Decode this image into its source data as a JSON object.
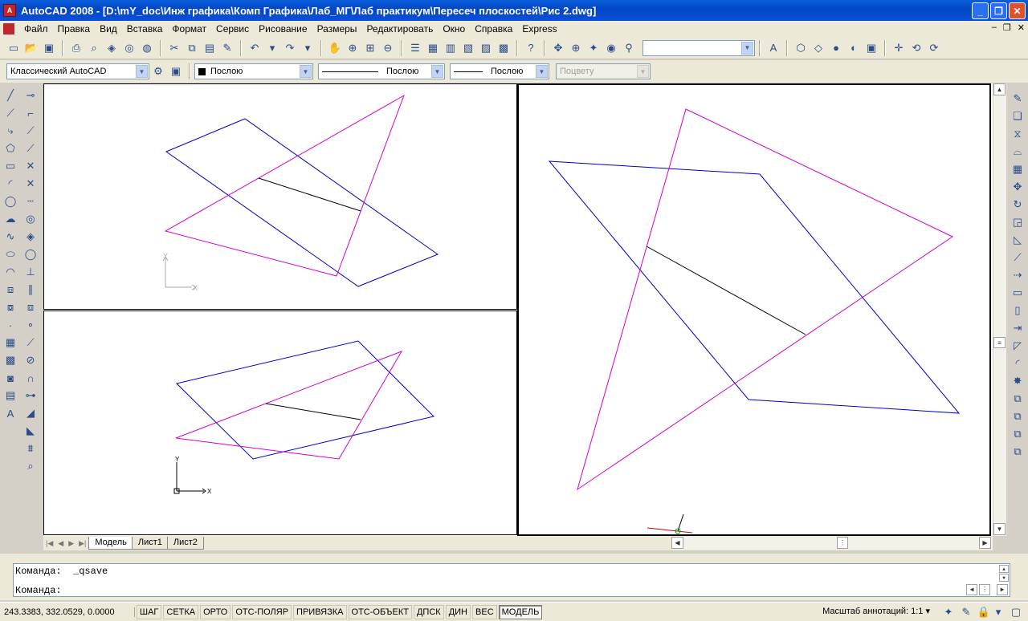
{
  "window": {
    "title": "AutoCAD 2008 - [D:\\mY_doc\\Инж графика\\Комп Графика\\Лаб_МГ\\Лаб практикум\\Пересеч плоскостей\\Рис 2.dwg]",
    "logo_text": "A",
    "minimize": "_",
    "restore": "❐",
    "close": "✕"
  },
  "menu": {
    "items": [
      "Файл",
      "Правка",
      "Вид",
      "Вставка",
      "Формат",
      "Сервис",
      "Рисование",
      "Размеры",
      "Редактировать",
      "Окно",
      "Справка",
      "Express"
    ],
    "doc_minimize": "–",
    "doc_restore": "❐",
    "doc_close": "✕"
  },
  "toolbar": {
    "workspace": "Классический AutoCAD",
    "layer": "Послою",
    "linetype": "Послою",
    "lineweight": "Послою",
    "plotstyle": "Поцвету",
    "top_combo_value": ""
  },
  "tabs": [
    "Модель",
    "Лист1",
    "Лист2"
  ],
  "command": {
    "line1": "Команда:  _qsave",
    "line2": "Команда:"
  },
  "status": {
    "coords": "243.3383, 332.0529, 0.0000",
    "buttons": [
      {
        "label": "ШАГ",
        "active": false
      },
      {
        "label": "СЕТКА",
        "active": false
      },
      {
        "label": "ОРТО",
        "active": false
      },
      {
        "label": "ОТС-ПОЛЯР",
        "active": false
      },
      {
        "label": "ПРИВЯЗКА",
        "active": false
      },
      {
        "label": "ОТС-ОБЪЕКТ",
        "active": false
      },
      {
        "label": "ДПСК",
        "active": false
      },
      {
        "label": "ДИН",
        "active": false
      },
      {
        "label": "ВЕС",
        "active": false
      },
      {
        "label": "МОДЕЛЬ",
        "active": true
      }
    ],
    "annotation_scale": "Масштаб аннотаций: 1:1 ▾"
  },
  "ucs": {
    "x": "X",
    "y": "Y"
  },
  "colors": {
    "plane_a": "#0000c8",
    "plane_b": "#d000d0",
    "intersection": "#000000"
  }
}
